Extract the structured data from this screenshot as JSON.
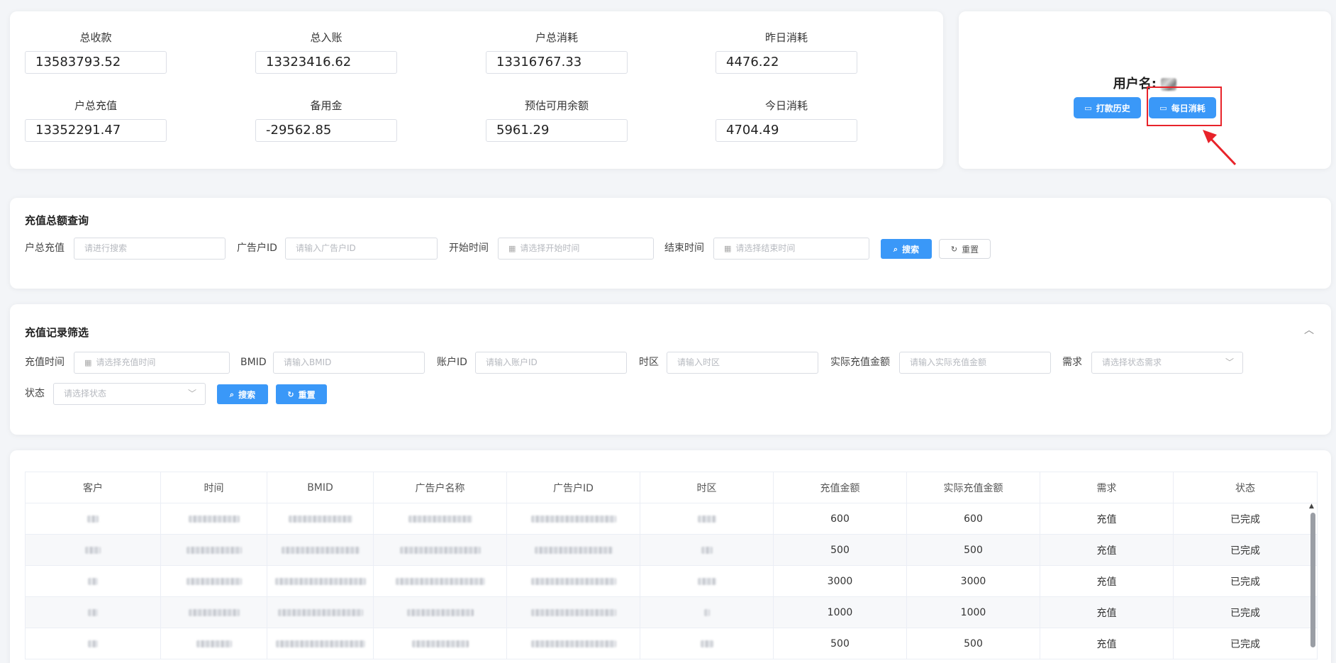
{
  "stats": [
    {
      "label": "总收款",
      "value": "13583793.52"
    },
    {
      "label": "总入账",
      "value": "13323416.62"
    },
    {
      "label": "户总消耗",
      "value": "13316767.33"
    },
    {
      "label": "昨日消耗",
      "value": "4476.22"
    },
    {
      "label": "户总充值",
      "value": "13352291.47"
    },
    {
      "label": "备用金",
      "value": "-29562.85"
    },
    {
      "label": "预估可用余额",
      "value": "5961.29"
    },
    {
      "label": "今日消耗",
      "value": "4704.49"
    }
  ],
  "user": {
    "username_label": "用户名:",
    "history_button": "打款历史",
    "daily_button": "每日消耗"
  },
  "query": {
    "title": "充值总额查询",
    "fields": [
      {
        "label": "户总充值",
        "placeholder": "请进行搜索"
      },
      {
        "label": "广告户ID",
        "placeholder": "请输入广告户ID"
      },
      {
        "label": "开始时间",
        "placeholder": "请选择开始时间"
      },
      {
        "label": "结束时间",
        "placeholder": "请选择结束时间"
      }
    ],
    "search_button": "搜索",
    "reset_button": "重置"
  },
  "filter": {
    "title": "充值记录筛选",
    "fields": [
      {
        "label": "充值时间",
        "placeholder": "请选择充值时间"
      },
      {
        "label": "BMID",
        "placeholder": "请输入BMID"
      },
      {
        "label": "账户ID",
        "placeholder": "请输入账户ID"
      },
      {
        "label": "时区",
        "placeholder": "请输入时区"
      },
      {
        "label": "实际充值金额",
        "placeholder": "请输入实际充值金额"
      },
      {
        "label": "需求",
        "placeholder": "请选择状态需求"
      },
      {
        "label": "状态",
        "placeholder": "请选择状态"
      }
    ],
    "search_button": "搜索",
    "reset_button": "重置"
  },
  "table": {
    "columns": [
      "客户",
      "时间",
      "BMID",
      "广告户名称",
      "广告户ID",
      "时区",
      "充值金额",
      "实际充值金额",
      "需求",
      "状态"
    ],
    "rows": [
      {
        "amount": "600",
        "actual": "600",
        "demand": "充值",
        "status": "已完成"
      },
      {
        "amount": "500",
        "actual": "500",
        "demand": "充值",
        "status": "已完成"
      },
      {
        "amount": "3000",
        "actual": "3000",
        "demand": "充值",
        "status": "已完成"
      },
      {
        "amount": "1000",
        "actual": "1000",
        "demand": "充值",
        "status": "已完成"
      },
      {
        "amount": "500",
        "actual": "500",
        "demand": "充值",
        "status": "已完成"
      }
    ]
  },
  "colors": {
    "primary": "#3a98f8",
    "highlight": "#e8232a",
    "background": "#f3f5f8"
  },
  "icons": [
    "calendar-icon",
    "search-icon",
    "refresh-icon",
    "wallet-icon",
    "chevron-down-icon",
    "chevron-up-icon",
    "red-arrow-annotation"
  ]
}
